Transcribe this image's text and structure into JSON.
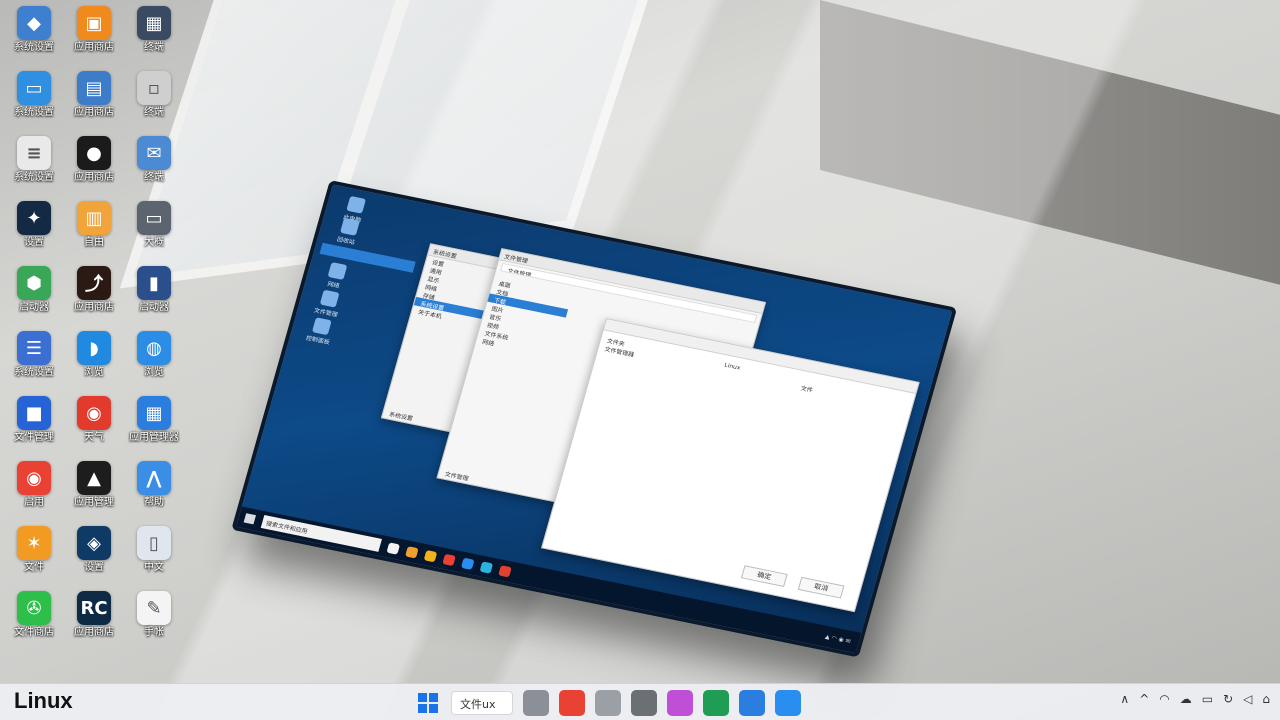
{
  "desktop": {
    "icons": [
      {
        "label": "系统设置",
        "icon": "shield-app-icon",
        "color": "#3f7fd0",
        "glyph": "◆"
      },
      {
        "label": "应用商店",
        "icon": "store-bag-icon",
        "color": "#f08a1c",
        "glyph": "▣"
      },
      {
        "label": "终端",
        "icon": "grid-apps-icon",
        "color": "#3a4a63",
        "glyph": "▦"
      },
      {
        "label": "系统设置",
        "icon": "monitor-icon",
        "color": "#2f8fe0",
        "glyph": "▭"
      },
      {
        "label": "应用商店",
        "icon": "store-window-icon",
        "color": "#3c7cc9",
        "glyph": "▤"
      },
      {
        "label": "终端",
        "icon": "blank-file-icon",
        "color": "#cfcfcf",
        "glyph": "▫"
      },
      {
        "label": "系统设置",
        "icon": "document-icon",
        "color": "#e9e9e9",
        "glyph": "≡"
      },
      {
        "label": "应用商店",
        "icon": "penguin-icon",
        "color": "#1b1b1b",
        "glyph": "●"
      },
      {
        "label": "终端",
        "icon": "chat-bubbles-icon",
        "color": "#4d8ad4",
        "glyph": "✉"
      },
      {
        "label": "设置",
        "icon": "security-shield-icon",
        "color": "#142a44",
        "glyph": "✦"
      },
      {
        "label": "自由",
        "icon": "notebook-icon",
        "color": "#f1a43a",
        "glyph": "▥"
      },
      {
        "label": "大概",
        "icon": "terminal-icon",
        "color": "#5c6470",
        "glyph": "▭"
      },
      {
        "label": "启动器",
        "icon": "green-badge-icon",
        "color": "#3aa657",
        "glyph": "⬢"
      },
      {
        "label": "应用商店",
        "icon": "stock-chart-icon",
        "color": "#2b1a14",
        "glyph": "⤴"
      },
      {
        "label": "启动器",
        "icon": "building-icon",
        "color": "#2b4f8c",
        "glyph": "▮"
      },
      {
        "label": "系统设置",
        "icon": "layers-icon",
        "color": "#3b6fd1",
        "glyph": "☰"
      },
      {
        "label": "浏览",
        "icon": "bird-icon",
        "color": "#1f8ae0",
        "glyph": "◗"
      },
      {
        "label": "浏览",
        "icon": "browser-icon",
        "color": "#2c8de6",
        "glyph": "◍"
      },
      {
        "label": "文件管理",
        "icon": "cube-icon",
        "color": "#2563d6",
        "glyph": "■"
      },
      {
        "label": "天气",
        "icon": "weibo-icon",
        "color": "#e23b2e",
        "glyph": "◉"
      },
      {
        "label": "应用管理器",
        "icon": "app-grid-icon",
        "color": "#2b7de0",
        "glyph": "▦"
      },
      {
        "label": "启用",
        "icon": "chrome-icon",
        "color": "#e94235",
        "glyph": "◉"
      },
      {
        "label": "应用管理",
        "icon": "red-chart-icon",
        "color": "#1d1d1d",
        "glyph": "▲"
      },
      {
        "label": "帮助",
        "icon": "feather-icon",
        "color": "#3a8ee6",
        "glyph": "⋀"
      },
      {
        "label": "文件",
        "icon": "pinwheel-icon",
        "color": "#f29b22",
        "glyph": "✶"
      },
      {
        "label": "设置",
        "icon": "dark-shield-icon",
        "color": "#0f3a66",
        "glyph": "◈"
      },
      {
        "label": "中文",
        "icon": "book-icon",
        "color": "#dfe6ee",
        "glyph": "▯"
      },
      {
        "label": "文件商店",
        "icon": "wechat-icon",
        "color": "#2dbf4a",
        "glyph": "✇"
      },
      {
        "label": "应用商店",
        "icon": "rc-icon",
        "color": "#0f2a44",
        "glyph": "RC"
      },
      {
        "label": "手帐",
        "icon": "paint-icon",
        "color": "#f4f4f4",
        "glyph": "✎"
      }
    ]
  },
  "laptop": {
    "sidebar_icons": [
      {
        "label": "此电脑",
        "icon": "pc-icon"
      },
      {
        "label": "回收站",
        "icon": "recycle-icon"
      },
      {
        "label": "网络",
        "icon": "network-icon"
      },
      {
        "label": "文件管理",
        "icon": "folder-icon"
      },
      {
        "label": "控制面板",
        "icon": "panel-icon"
      }
    ],
    "settings_window": {
      "title": "系统设置",
      "items": [
        "设置",
        "通用",
        "显示",
        "网络",
        "存储",
        "系统设置",
        "关于本机"
      ],
      "footer": "系统设置"
    },
    "file_window": {
      "title": "文件管理",
      "path": "文件管理",
      "items": [
        "桌面",
        "文档",
        "下载",
        "图片",
        "音乐",
        "视频",
        "文件系统",
        "网络"
      ],
      "status": "文件管理"
    },
    "dialog": {
      "files": [
        "文件夹",
        "文件管理器",
        "Linux",
        "文件"
      ],
      "ok_label": "确定",
      "cancel_label": "取消"
    },
    "search_placeholder": "搜索文件和应用"
  },
  "taskbar": {
    "os_label": "Linux",
    "search_text": "文件ux",
    "apps": [
      {
        "icon": "start-icon",
        "color": "#1a73e8"
      },
      {
        "icon": "folder-gray-icon",
        "color": "#8a8f98"
      },
      {
        "icon": "chrome-taskbar-icon",
        "color": "#e94235"
      },
      {
        "icon": "files-taskbar-icon",
        "color": "#9aa0a6"
      },
      {
        "icon": "camera-taskbar-icon",
        "color": "#6b7075"
      },
      {
        "icon": "color-apps-icon",
        "color": "#c04fd8"
      },
      {
        "icon": "excel-icon",
        "color": "#1f9d55"
      },
      {
        "icon": "settings-taskbar-icon",
        "color": "#2b7de0"
      },
      {
        "icon": "store-taskbar-icon",
        "color": "#2a8ef0"
      }
    ],
    "tray_icons": [
      "chevron-up-icon",
      "up-arrow-icon",
      "wifi-icon",
      "cloud-icon",
      "battery-icon",
      "sync-icon",
      "volume-icon",
      "network-tray-icon"
    ]
  }
}
